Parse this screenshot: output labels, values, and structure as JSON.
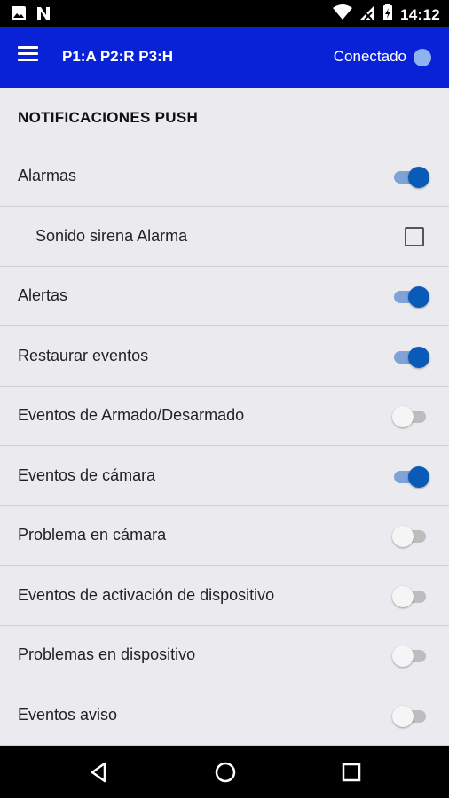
{
  "status_bar": {
    "time": "14:12",
    "left_icons": [
      "image-icon",
      "n-icon"
    ],
    "right_icons": [
      "wifi-icon",
      "signal-icon",
      "battery-icon"
    ]
  },
  "app_bar": {
    "title": "P1:A P2:R P3:H",
    "connection_label": "Conectado",
    "background": "#0a22d6",
    "connection_dot_color": "#8fb3ee"
  },
  "section": {
    "header": "NOTIFICACIONES PUSH"
  },
  "settings": [
    {
      "label": "Alarmas",
      "control": "switch",
      "checked": true
    },
    {
      "label": "Sonido sirena Alarma",
      "control": "checkbox",
      "checked": false,
      "indented": true
    },
    {
      "label": "Alertas",
      "control": "switch",
      "checked": true
    },
    {
      "label": "Restaurar eventos",
      "control": "switch",
      "checked": true
    },
    {
      "label": "Eventos de Armado/Desarmado",
      "control": "switch",
      "checked": false
    },
    {
      "label": "Eventos de cámara",
      "control": "switch",
      "checked": true
    },
    {
      "label": "Problema en cámara",
      "control": "switch",
      "checked": false
    },
    {
      "label": "Eventos de activación de dispositivo",
      "control": "switch",
      "checked": false
    },
    {
      "label": "Problemas en dispositivo",
      "control": "switch",
      "checked": false
    },
    {
      "label": "Eventos aviso",
      "control": "switch",
      "checked": false
    }
  ],
  "colors": {
    "switch_on_thumb": "#0a5bb8",
    "switch_on_track": "#7fa3d8",
    "switch_off_thumb": "#f5f5f5",
    "switch_off_track": "#bdbdbd"
  },
  "nav_bar": {
    "buttons": [
      "back-icon",
      "home-icon",
      "recents-icon"
    ]
  }
}
